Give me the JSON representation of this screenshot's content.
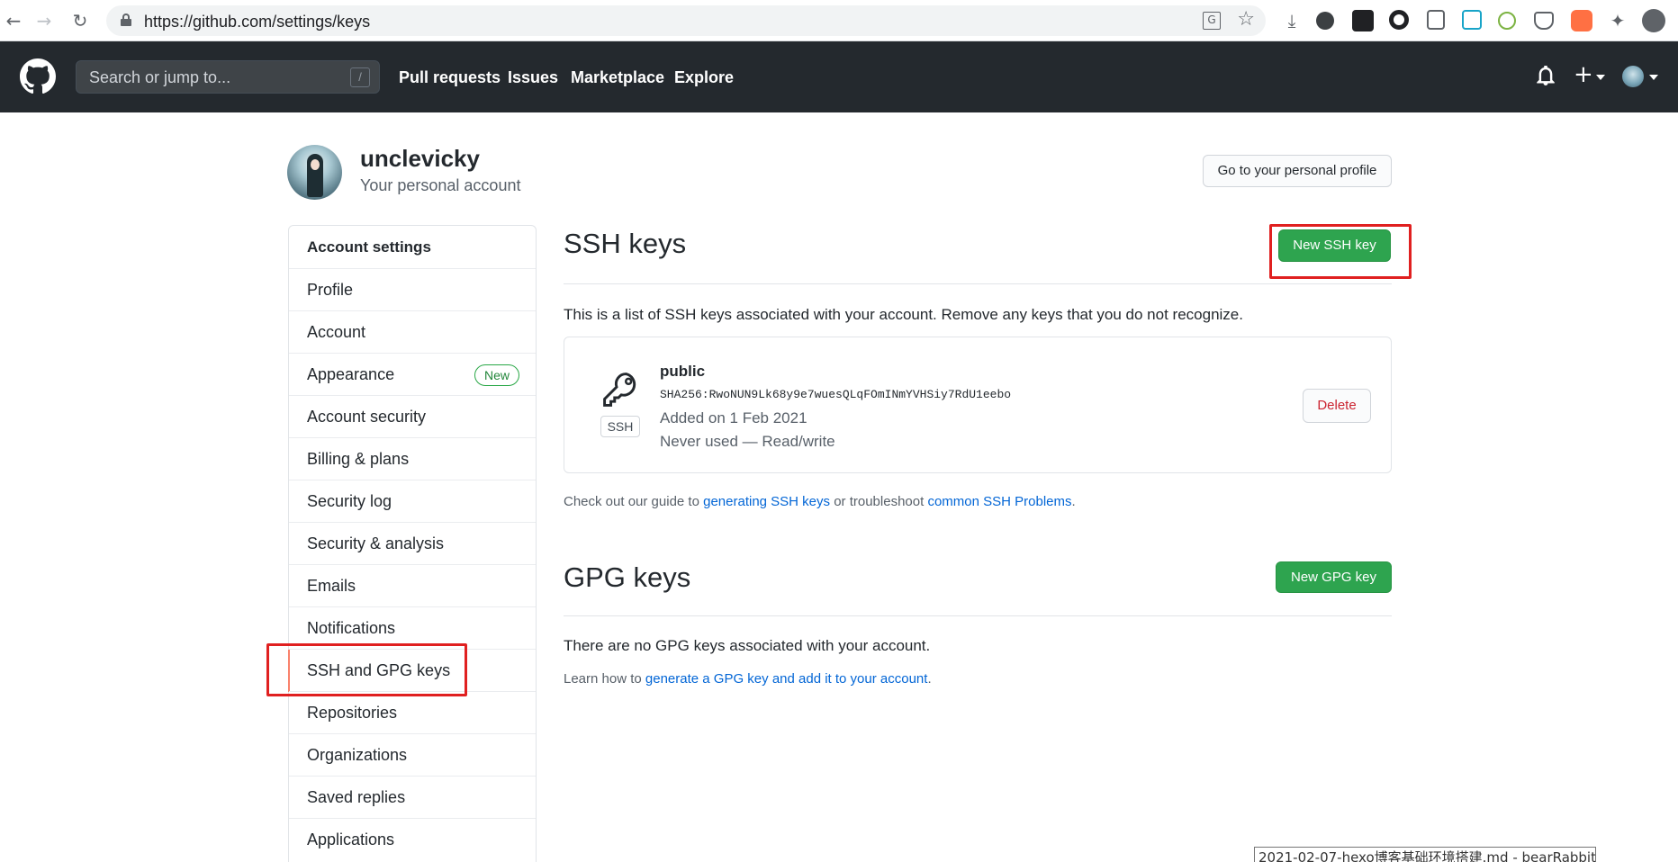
{
  "browser": {
    "url": "https://github.com/settings/keys"
  },
  "header": {
    "search_placeholder": "Search or jump to...",
    "search_shortcut": "/",
    "nav": [
      "Pull requests",
      "Issues",
      "Marketplace",
      "Explore"
    ],
    "plus": "+"
  },
  "profile": {
    "username": "unclevicky",
    "subtitle": "Your personal account",
    "profile_button": "Go to your personal profile"
  },
  "sidebar": {
    "title": "Account settings",
    "items": [
      {
        "label": "Profile"
      },
      {
        "label": "Account"
      },
      {
        "label": "Appearance",
        "badge": "New"
      },
      {
        "label": "Account security"
      },
      {
        "label": "Billing & plans"
      },
      {
        "label": "Security log"
      },
      {
        "label": "Security & analysis"
      },
      {
        "label": "Emails"
      },
      {
        "label": "Notifications"
      },
      {
        "label": "SSH and GPG keys",
        "selected": true
      },
      {
        "label": "Repositories"
      },
      {
        "label": "Organizations"
      },
      {
        "label": "Saved replies"
      },
      {
        "label": "Applications"
      }
    ]
  },
  "ssh": {
    "title": "SSH keys",
    "new_button": "New SSH key",
    "description": "This is a list of SSH keys associated with your account. Remove any keys that you do not recognize.",
    "key": {
      "type_badge": "SSH",
      "name": "public",
      "fingerprint": "SHA256:RwoNUN9Lk68y9e7wuesQLqFOmINmYVHSiy7RdU1eebo",
      "added": "Added on 1 Feb 2021",
      "usage": "Never used — Read/write",
      "delete_button": "Delete"
    },
    "help_prefix": "Check out our guide to ",
    "help_link1": "generating SSH keys",
    "help_middle": " or troubleshoot ",
    "help_link2": "common SSH Problems",
    "help_suffix": "."
  },
  "gpg": {
    "title": "GPG keys",
    "new_button": "New GPG key",
    "empty_text": "There are no GPG keys associated with your account.",
    "help_prefix": "Learn how to ",
    "help_link": "generate a GPG key and add it to your account",
    "help_suffix": "."
  },
  "tooltip": "2021-02-07-hexo博客基础环境搭建.md - bearRabbit",
  "colors": {
    "header_bg": "#24292e",
    "primary_green": "#2ea44f",
    "link_blue": "#0366d6",
    "danger_red": "#cb2431",
    "annotation_red": "#e02020",
    "selected_accent": "#f9826c"
  }
}
